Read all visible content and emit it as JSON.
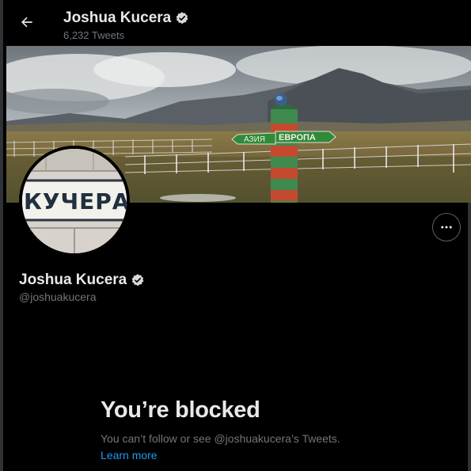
{
  "header": {
    "name": "Joshua Kucera",
    "tweet_count": "6,232 Tweets"
  },
  "banner": {
    "sign_left": "АЗИЯ",
    "sign_right": "ЕВРОПА"
  },
  "avatar": {
    "sign_text": "КУЧЕРА"
  },
  "profile": {
    "name": "Joshua Kucera",
    "handle": "@joshuakucera"
  },
  "blocked": {
    "title": "You’re blocked",
    "message": "You can’t follow or see @joshuakucera’s Tweets.",
    "link": "Learn more"
  },
  "colors": {
    "background": "#000000",
    "primary_text": "#e7e9ea",
    "secondary_text": "#71767b",
    "link": "#1d9bf0"
  },
  "icons": {
    "back": "arrow-left-icon",
    "verified": "verified-badge-icon",
    "more": "more-horizontal-icon"
  }
}
